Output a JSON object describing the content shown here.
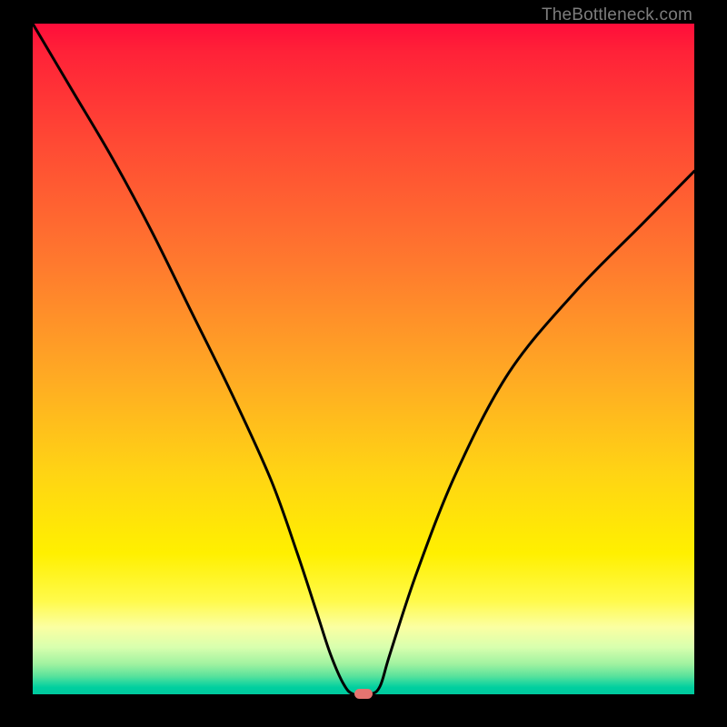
{
  "watermark": "TheBottleneck.com",
  "chart_data": {
    "type": "line",
    "title": "",
    "xlabel": "",
    "ylabel": "",
    "xlim": [
      0,
      100
    ],
    "ylim": [
      0,
      100
    ],
    "series": [
      {
        "name": "bottleneck-curve",
        "x": [
          0,
          6,
          12,
          18,
          24,
          30,
          36,
          40,
          43,
          45,
          47,
          48.5,
          51,
          52.5,
          54,
          58,
          64,
          72,
          82,
          92,
          100
        ],
        "values": [
          100,
          90,
          80,
          69,
          57,
          45,
          32,
          21,
          12,
          6,
          1.5,
          0,
          0,
          1.2,
          6,
          18,
          33,
          48,
          60,
          70,
          78
        ]
      }
    ],
    "marker": {
      "x": 50,
      "y": 0,
      "color": "#e57470"
    },
    "background_gradient": {
      "top": "#ff0d3a",
      "mid": "#fff000",
      "bottom": "#00c99e"
    }
  }
}
